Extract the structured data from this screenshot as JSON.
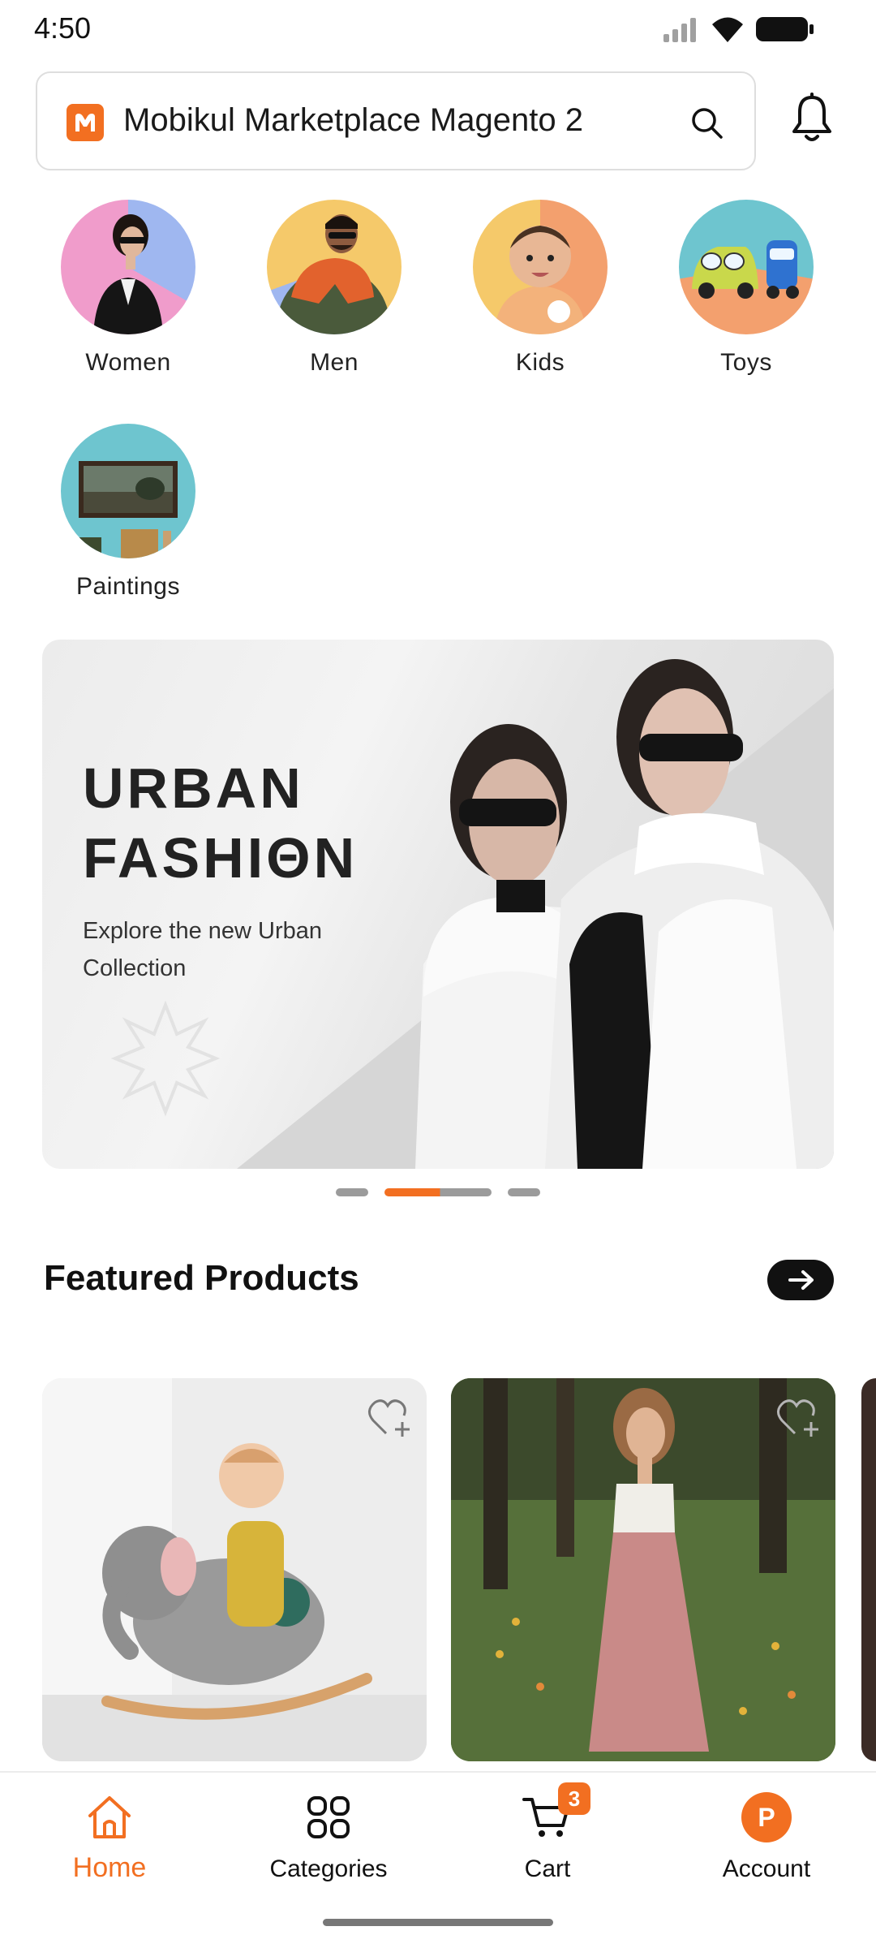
{
  "status_bar": {
    "time": "4:50",
    "icons": [
      "signal-icon",
      "wifi-icon",
      "battery-icon"
    ]
  },
  "header": {
    "search_text": "Mobikul Marketplace Magento 2",
    "icons": [
      "brand-logo-icon",
      "search-icon",
      "bell-icon"
    ]
  },
  "categories": [
    {
      "label": "Women"
    },
    {
      "label": "Men"
    },
    {
      "label": "Kids"
    },
    {
      "label": "Toys"
    },
    {
      "label": "Paintings"
    }
  ],
  "banner": {
    "title": "URBAN\nFASHIΘN",
    "subtitle": "Explore the new Urban Collection",
    "slide": 2,
    "slide_count": 3
  },
  "featured": {
    "title": "Featured Products",
    "more_icon": "arrow-right-icon"
  },
  "products": [
    {
      "image": "baby-on-rocking-elephant",
      "wishlist_icon": "heart-plus-icon"
    },
    {
      "image": "woman-in-floral-skirt",
      "wishlist_icon": "heart-plus-icon"
    }
  ],
  "bottom_nav": {
    "items": [
      {
        "label": "Home",
        "icon": "home-icon",
        "active": true
      },
      {
        "label": "Categories",
        "icon": "grid-icon"
      },
      {
        "label": "Cart",
        "icon": "cart-icon",
        "badge": "3"
      },
      {
        "label": "Account",
        "icon": "avatar",
        "avatar_letter": "P"
      }
    ]
  },
  "colors": {
    "accent": "#f26f21",
    "text": "#111111"
  }
}
